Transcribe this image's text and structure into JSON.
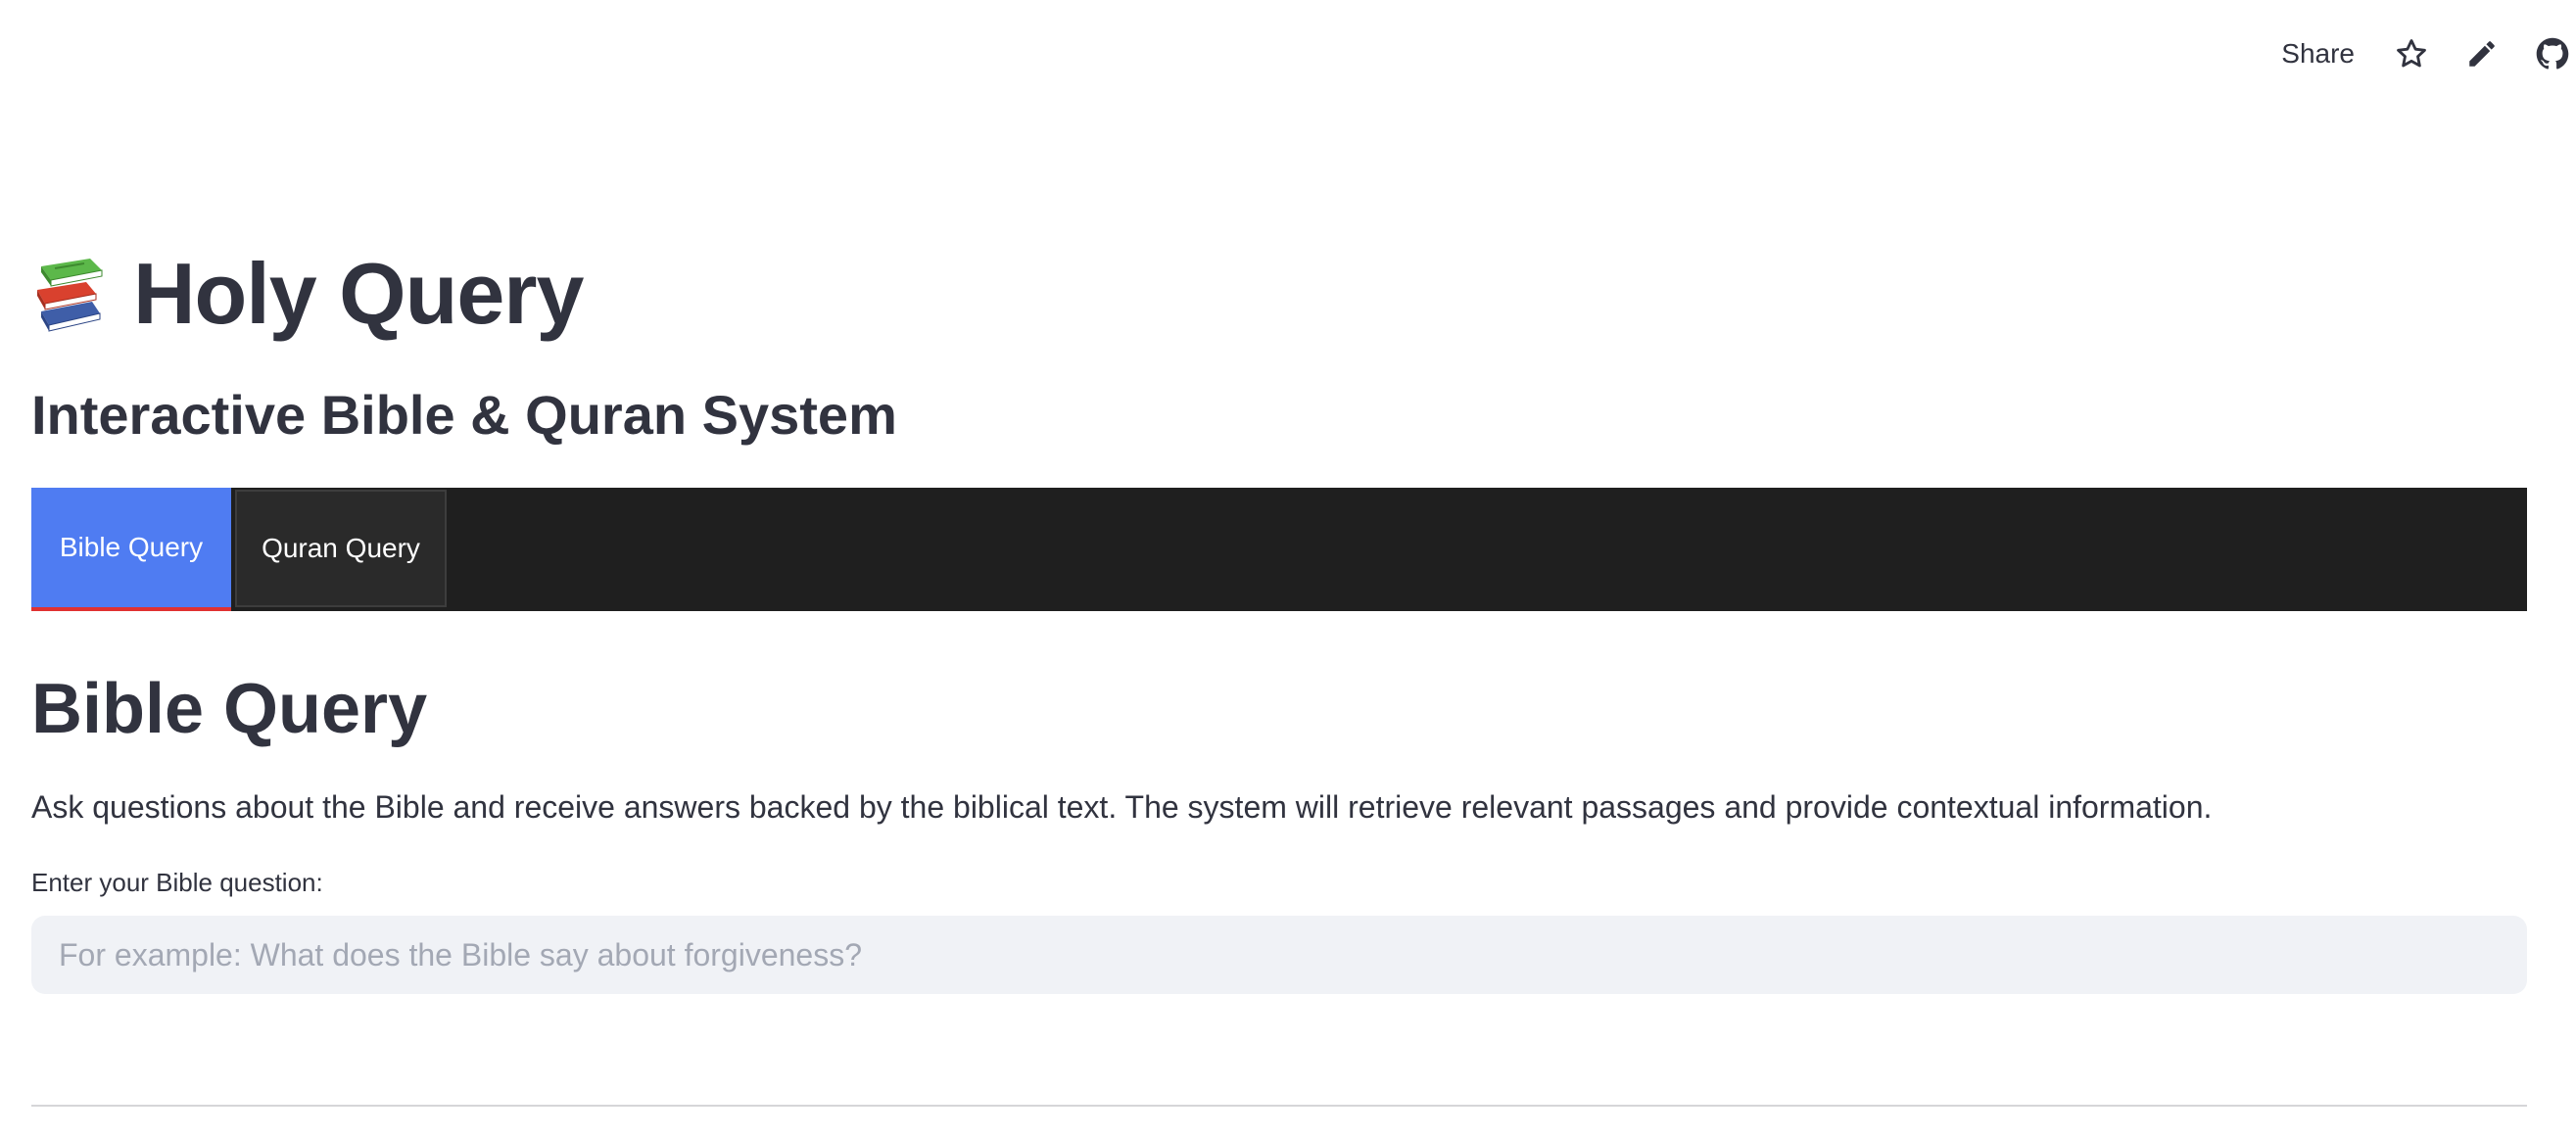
{
  "toolbar": {
    "share_label": "Share",
    "icons": [
      "star-icon",
      "pencil-icon",
      "github-icon"
    ]
  },
  "header": {
    "icon": "books-icon",
    "title": "Holy Query",
    "subtitle": "Interactive Bible & Quran System"
  },
  "tabs": [
    {
      "label": "Bible Query",
      "active": true
    },
    {
      "label": "Quran Query",
      "active": false
    }
  ],
  "section": {
    "title": "Bible Query",
    "description": "Ask questions about the Bible and receive answers backed by the biblical text. The system will retrieve relevant passages and provide contextual information.",
    "input_label": "Enter your Bible question:",
    "input_value": "",
    "input_placeholder": "For example: What does the Bible say about forgiveness?"
  },
  "colors": {
    "accent": "#4f7cf2",
    "tab_underline": "#e03131",
    "tabbar_background": "#1f1f1f",
    "text": "#31333f",
    "input_background": "#f0f2f6"
  }
}
